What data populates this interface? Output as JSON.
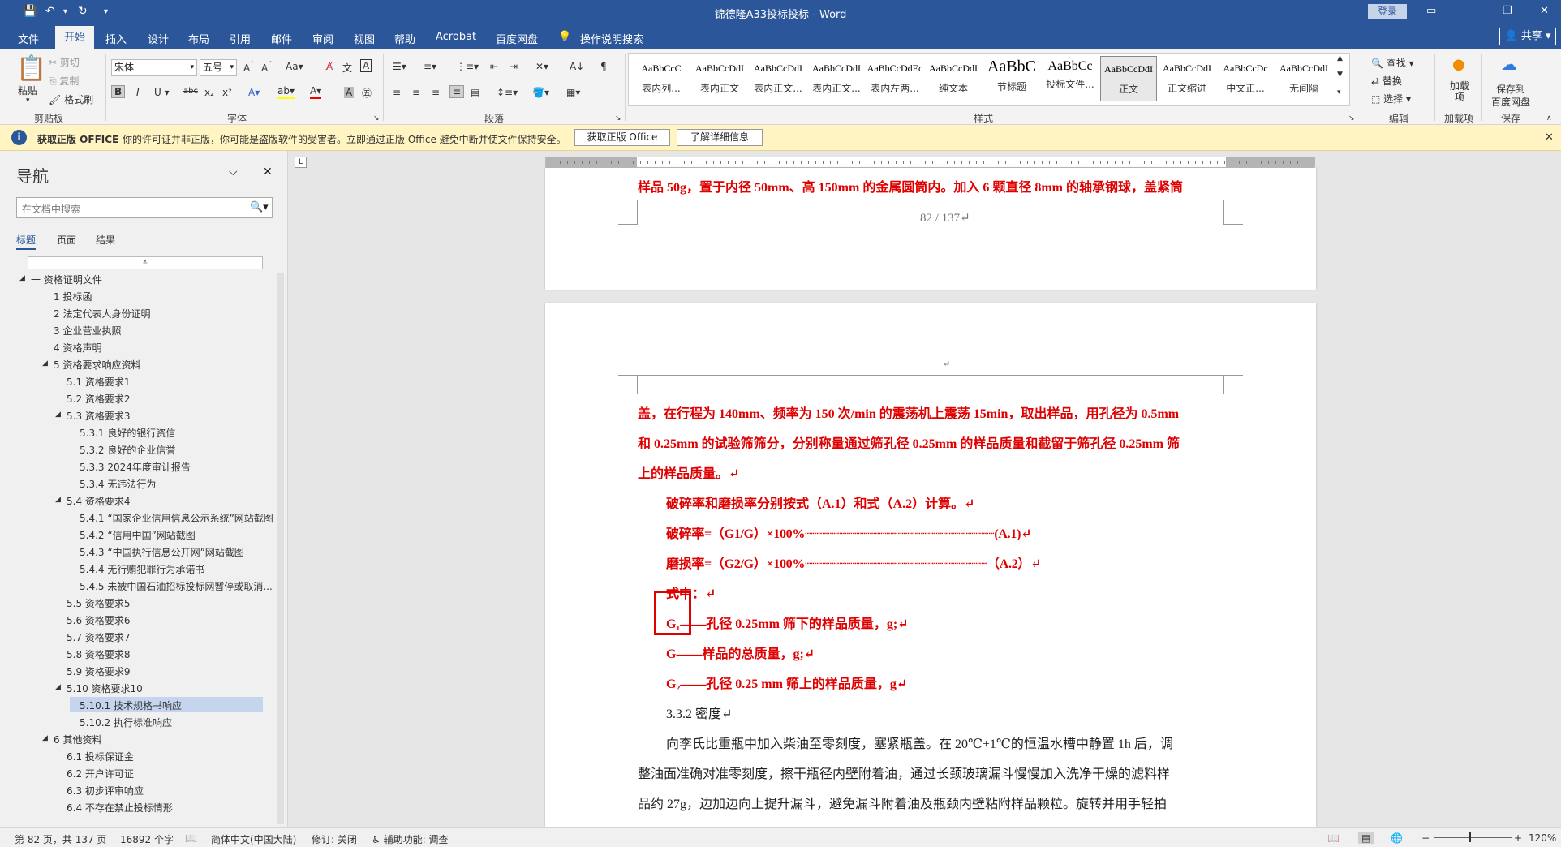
{
  "title_bar": {
    "title": "锦德隆A33投标投标 - Word",
    "login": "登录"
  },
  "menu": {
    "items": [
      "文件",
      "开始",
      "插入",
      "设计",
      "布局",
      "引用",
      "邮件",
      "审阅",
      "视图",
      "帮助",
      "Acrobat",
      "百度网盘"
    ],
    "tell_me": "操作说明搜索",
    "share": "共享"
  },
  "ribbon": {
    "clipboard": {
      "paste": "粘贴",
      "cut": "剪切",
      "copy": "复制",
      "format_painter": "格式刷",
      "label": "剪贴板"
    },
    "font": {
      "name": "宋体",
      "size": "五号",
      "label": "字体"
    },
    "paragraph": {
      "label": "段落"
    },
    "styles": {
      "label": "样式",
      "items": [
        {
          "preview": "AaBbCcC",
          "name": "表内列..."
        },
        {
          "preview": "AaBbCcDdI",
          "name": "表内正文"
        },
        {
          "preview": "AaBbCcDdI",
          "name": "表内正文..."
        },
        {
          "preview": "AaBbCcDdI",
          "name": "表内正文..."
        },
        {
          "preview": "AaBbCcDdEc",
          "name": "表内左两..."
        },
        {
          "preview": "AaBbCcDdI",
          "name": "纯文本"
        },
        {
          "preview": "AaBbC",
          "name": "节标题"
        },
        {
          "preview": "AaBbCc",
          "name": "投标文件..."
        },
        {
          "preview": "AaBbCcDdI",
          "name": "正文"
        },
        {
          "preview": "AaBbCcDdI",
          "name": "正文缩进"
        },
        {
          "preview": "AaBbCcDc",
          "name": "中文正..."
        },
        {
          "preview": "AaBbCcDdI",
          "name": "无间隔"
        }
      ]
    },
    "editing": {
      "find": "查找",
      "replace": "替换",
      "select": "选择",
      "label": "编辑"
    },
    "addins": {
      "btn": "加载项",
      "label": "加载项"
    },
    "save": {
      "btn1": "保存到",
      "btn2": "百度网盘",
      "label": "保存"
    }
  },
  "notice": {
    "title": "获取正版 OFFICE",
    "message": "你的许可证并非正版，你可能是盗版软件的受害者。立即通过正版 Office 避免中断并使文件保持安全。",
    "btn1": "获取正版 Office",
    "btn2": "了解详细信息"
  },
  "nav": {
    "title": "导航",
    "search_placeholder": "在文档中搜索",
    "tabs": [
      "标题",
      "页面",
      "结果"
    ],
    "tree": [
      {
        "text": "一 资格证明文件",
        "level": 0,
        "exp": true
      },
      {
        "text": "1 投标函",
        "level": 1
      },
      {
        "text": "2 法定代表人身份证明",
        "level": 1
      },
      {
        "text": "3 企业营业执照",
        "level": 1
      },
      {
        "text": "4 资格声明",
        "level": 1
      },
      {
        "text": "5 资格要求响应资料",
        "level": 1,
        "exp": true
      },
      {
        "text": "5.1 资格要求1",
        "level": 2
      },
      {
        "text": "5.2 资格要求2",
        "level": 2
      },
      {
        "text": "5.3 资格要求3",
        "level": 2,
        "exp": true
      },
      {
        "text": "5.3.1 良好的银行资信",
        "level": 3
      },
      {
        "text": "5.3.2 良好的企业信誉",
        "level": 3
      },
      {
        "text": "5.3.3 2024年度审计报告",
        "level": 3
      },
      {
        "text": "5.3.4 无违法行为",
        "level": 3
      },
      {
        "text": "5.4 资格要求4",
        "level": 2,
        "exp": true
      },
      {
        "text": "5.4.1 “国家企业信用信息公示系统”网站截图",
        "level": 3
      },
      {
        "text": "5.4.2 “信用中国”网站截图",
        "level": 3
      },
      {
        "text": "5.4.3 “中国执行信息公开网”网站截图",
        "level": 3
      },
      {
        "text": "5.4.4 无行贿犯罪行为承诺书",
        "level": 3
      },
      {
        "text": "5.4.5 未被中国石油招标投标网暂停或取消...",
        "level": 3
      },
      {
        "text": "5.5 资格要求5",
        "level": 2
      },
      {
        "text": "5.6 资格要求6",
        "level": 2
      },
      {
        "text": "5.7 资格要求7",
        "level": 2
      },
      {
        "text": "5.8 资格要求8",
        "level": 2
      },
      {
        "text": "5.9 资格要求9",
        "level": 2
      },
      {
        "text": "5.10 资格要求10",
        "level": 2,
        "exp": true
      },
      {
        "text": "5.10.1 技术规格书响应",
        "level": 3,
        "sel": true
      },
      {
        "text": "5.10.2 执行标准响应",
        "level": 3
      },
      {
        "text": "6 其他资料",
        "level": 1,
        "exp": true
      },
      {
        "text": "6.1 投标保证金",
        "level": 2
      },
      {
        "text": "6.2 开户许可证",
        "level": 2
      },
      {
        "text": "6.3 初步评审响应",
        "level": 2
      },
      {
        "text": "6.4 不存在禁止投标情形",
        "level": 2
      }
    ]
  },
  "document": {
    "page1_top": "样品 50g，置于内径 50mm、高 150mm 的金属圆筒内。加入 6 颗直径 8mm 的轴承钢球，盖紧筒",
    "page_number": "82 / 137↵",
    "header_mark": "↵",
    "lines": [
      "盖，在行程为 140mm、频率为 150 次/min 的震荡机上震荡 15min，取出样品，用孔径为 0.5mm",
      "和 0.25mm 的试验筛筛分，分别称量通过筛孔径 0.25mm 的样品质量和截留于筛孔径 0.25mm 筛",
      "上的样品质量。↵",
      "破碎率和磨损率分别按式（A.1）和式（A.2）计算。↵",
      "破碎率=（G1/G）×100%┈┈┈┈┈┈┈┈┈┈┈┈┈┈┈┈┈┈┈┈┈┈┈┈┈(A.1)↵",
      "磨损率=（G2/G）×100%┈┈┈┈┈┈┈┈┈┈┈┈┈┈┈┈┈┈┈┈┈┈┈┈（A.2）↵",
      "式中：↵",
      "G₁——孔径 0.25mm 筛下的样品质量，g;↵",
      "G——样品的总质量，g;↵",
      "G₂——孔径 0.25 mm 筛上的样品质量，g↵",
      "3.3.2 密度↵",
      "向李氏比重瓶中加入柴油至零刻度，塞紧瓶盖。在 20℃+1℃的恒温水槽中静置 1h 后，调",
      "整油面准确对准零刻度，擦干瓶径内壁附着油，通过长颈玻璃漏斗慢慢加入洗净干燥的滤料样",
      "品约 27g，边加边向上提升漏斗，避免漏斗附着油及瓶颈内壁粘附样品颗粒。旋转并用手轻拍"
    ]
  },
  "status": {
    "page": "第 82 页，共 137 页",
    "words": "16892 个字",
    "lang": "简体中文(中国大陆)",
    "track": "修订: 关闭",
    "access": "辅助功能: 调查",
    "zoom": "120%"
  }
}
